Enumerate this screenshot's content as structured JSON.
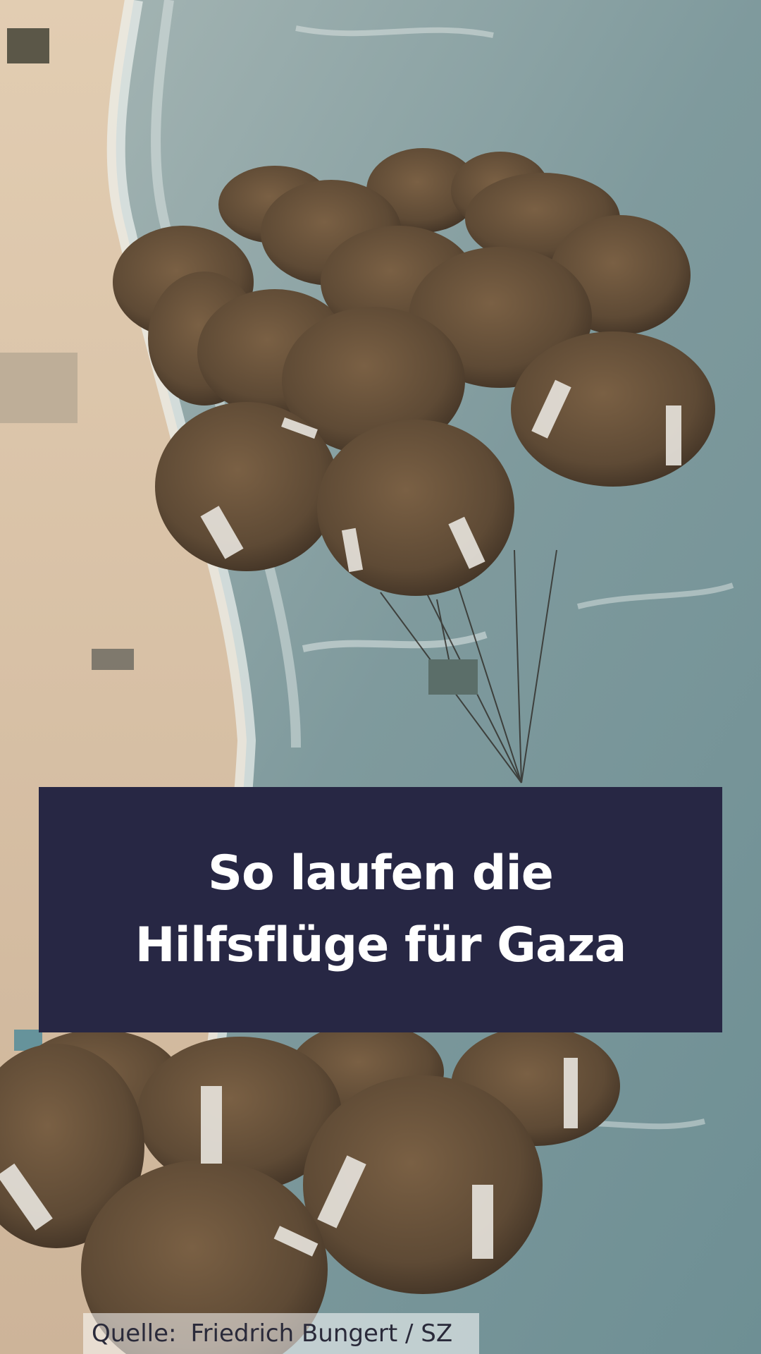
{
  "title": {
    "line1": "So laufen die",
    "line2": "Hilfsflüge für Gaza"
  },
  "credit": {
    "label": "Quelle:",
    "source": "Friedrich Bungert / SZ"
  },
  "colors": {
    "title_box": "#272744",
    "title_text": "#ffffff",
    "sea": "#7f9a9d",
    "sand": "#d9c3a6",
    "parachute": "#6b5338"
  }
}
